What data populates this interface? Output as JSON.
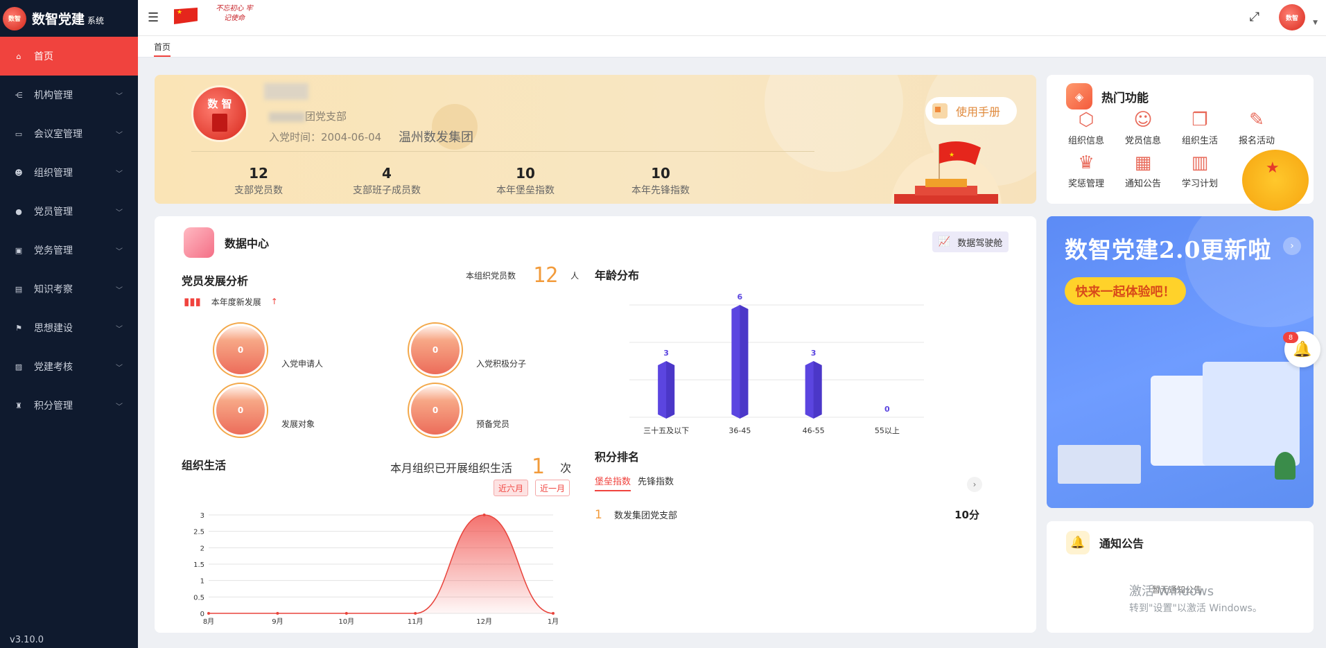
{
  "brand": {
    "title": "数智党建",
    "sub": "系统",
    "logo_text": "数智"
  },
  "sidebar": {
    "items": [
      {
        "label": "首页",
        "icon": "home-icon",
        "glyph": "⌂",
        "active": true
      },
      {
        "label": "机构管理",
        "icon": "org-structure-icon",
        "glyph": "⋲"
      },
      {
        "label": "会议室管理",
        "icon": "monitor-icon",
        "glyph": "▭"
      },
      {
        "label": "组织管理",
        "icon": "users-icon",
        "glyph": "☻"
      },
      {
        "label": "党员管理",
        "icon": "user-icon",
        "glyph": "●"
      },
      {
        "label": "党务管理",
        "icon": "desktop-icon",
        "glyph": "▣"
      },
      {
        "label": "知识考察",
        "icon": "book-icon",
        "glyph": "▤"
      },
      {
        "label": "思想建设",
        "icon": "flag-icon",
        "glyph": "⚑"
      },
      {
        "label": "党建考核",
        "icon": "chart-icon",
        "glyph": "▨"
      },
      {
        "label": "积分管理",
        "icon": "trophy-icon",
        "glyph": "♜"
      }
    ],
    "version": "v3.10.0"
  },
  "topbar": {
    "slogan": "不忘初心 牢记使命",
    "avatar_text": "数智"
  },
  "tabs": [
    {
      "label": "首页"
    }
  ],
  "profile": {
    "branch_suffix": "团党支部",
    "join_label": "入党时间：",
    "join_date": "2004-06-04",
    "group": "温州数发集团",
    "manual_label": "使用手册",
    "avatar_text": "数 智",
    "stats": [
      {
        "num": "12",
        "label": "支部党员数"
      },
      {
        "num": "4",
        "label": "支部班子成员数"
      },
      {
        "num": "10",
        "label": "本年堡垒指数"
      },
      {
        "num": "10",
        "label": "本年先锋指数"
      }
    ]
  },
  "hot": {
    "title": "热门功能",
    "items": [
      {
        "label": "组织信息",
        "icon": "org-info-icon",
        "glyph": "⬡"
      },
      {
        "label": "党员信息",
        "icon": "member-info-icon",
        "glyph": "☺"
      },
      {
        "label": "组织生活",
        "icon": "org-life-icon",
        "glyph": "❐"
      },
      {
        "label": "报名活动",
        "icon": "signup-icon",
        "glyph": "✎"
      },
      {
        "label": "奖惩管理",
        "icon": "crown-icon",
        "glyph": "♛"
      },
      {
        "label": "通知公告",
        "icon": "notice-doc-icon",
        "glyph": "▦"
      },
      {
        "label": "学习计划",
        "icon": "calculator-icon",
        "glyph": "▥"
      }
    ]
  },
  "data_center": {
    "title": "数据中心",
    "cockpit_label": "数据驾驶舱",
    "dev_title": "党员发展分析",
    "member_count_label": "本组织党员数",
    "member_count": "12",
    "member_unit": "人",
    "new_dev_label": "本年度新发展",
    "bubbles": [
      {
        "value": "0",
        "label": "入党申请人"
      },
      {
        "value": "0",
        "label": "入党积极分子"
      },
      {
        "value": "0",
        "label": "发展对象"
      },
      {
        "value": "0",
        "label": "预备党员"
      }
    ],
    "org_life_title": "组织生活",
    "org_life_label": "本月组织已开展组织生活",
    "org_life_count": "1",
    "org_life_unit": "次",
    "range_buttons": [
      "近六月",
      "近一月"
    ],
    "age_title": "年龄分布",
    "rank_title": "积分排名",
    "rank_tabs": [
      "堡垒指数",
      "先锋指数"
    ],
    "rank_rows": [
      {
        "rank": "1",
        "name": "数发集团党支部",
        "score": "10分"
      }
    ]
  },
  "promo": {
    "title": "数智党建2.0更新啦",
    "subtitle": "快来一起体验吧！"
  },
  "bell_badge": "8",
  "notice": {
    "title": "通知公告",
    "empty": "暂无通知公告"
  },
  "watermark": {
    "line1": "激活 Windows",
    "line2": "转到\"设置\"以激活 Windows。"
  },
  "colors": {
    "accent": "#f0433e",
    "sidebar_bg": "#0f1a2e",
    "bar": "#5b45e0",
    "orange": "#f29b3b"
  },
  "chart_data": [
    {
      "type": "bar",
      "categories": [
        "三十五及以下",
        "36-45",
        "46-55",
        "55以上"
      ],
      "values": [
        3,
        6,
        3,
        0
      ],
      "ylim": [
        0,
        6
      ]
    },
    {
      "type": "area",
      "x": [
        "8月",
        "9月",
        "10月",
        "11月",
        "12月",
        "1月"
      ],
      "y": [
        0,
        0,
        0,
        0,
        3,
        0
      ],
      "yticks": [
        "0",
        "0.5",
        "1",
        "1.5",
        "2",
        "2.5",
        "3"
      ],
      "ylim": [
        0,
        3
      ]
    }
  ]
}
